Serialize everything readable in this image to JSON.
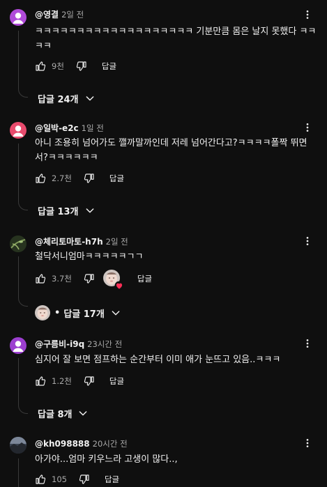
{
  "comments": [
    {
      "author": "@영결",
      "time": "2일 전",
      "text": "ㅋㅋㅋㅋㅋㅋㅋㅋㅋㅋㅋㅋㅋㅋㅋㅋㅋㅋㅋ 기분만큼 몸은 날지 못했다 ㅋㅋㅋㅋ",
      "likes": "9천",
      "reply_label": "답글",
      "replies_label": "답글 24개",
      "avatar_color": "#b04ad9"
    },
    {
      "author": "@일박-e2c",
      "time": "1일 전",
      "text": "아니 조용히 넘어가도 깰까말까인데 저레 넘어간다고?ㅋㅋㅋㅋ폴짝 뛰면서?ㅋㅋㅋㅋㅋㅋ",
      "likes": "2.7천",
      "reply_label": "답글",
      "replies_label": "답글 13개",
      "avatar_color": "#e84b6d"
    },
    {
      "author": "@체리토마토-h7h",
      "time": "2일 전",
      "text": "철닥서니엄마ㅋㅋㅋㅋㅋㄱㄱ",
      "likes": "3.7천",
      "reply_label": "답글",
      "replies_label": "답글 17개",
      "dot": "•"
    },
    {
      "author": "@구름비-i9q",
      "time": "23시간 전",
      "text": "심지어 잘 보면 점프하는 순간부터 이미 애가 눈뜨고 있음..ㅋㅋㅋ",
      "likes": "1.2천",
      "reply_label": "답글",
      "replies_label": "답글 8개",
      "avatar_color": "#9c3fd0"
    },
    {
      "author": "@kh098888",
      "time": "20시간 전",
      "text": "아가야...엄마 키우느라 고생이 많다..,",
      "likes": "105",
      "reply_label": "답글"
    }
  ],
  "icons": {
    "like": "thumbs-up-icon",
    "dislike": "thumbs-down-icon",
    "more": "more-vert-icon",
    "expand": "chevron-down-icon",
    "heart": "heart-icon"
  }
}
